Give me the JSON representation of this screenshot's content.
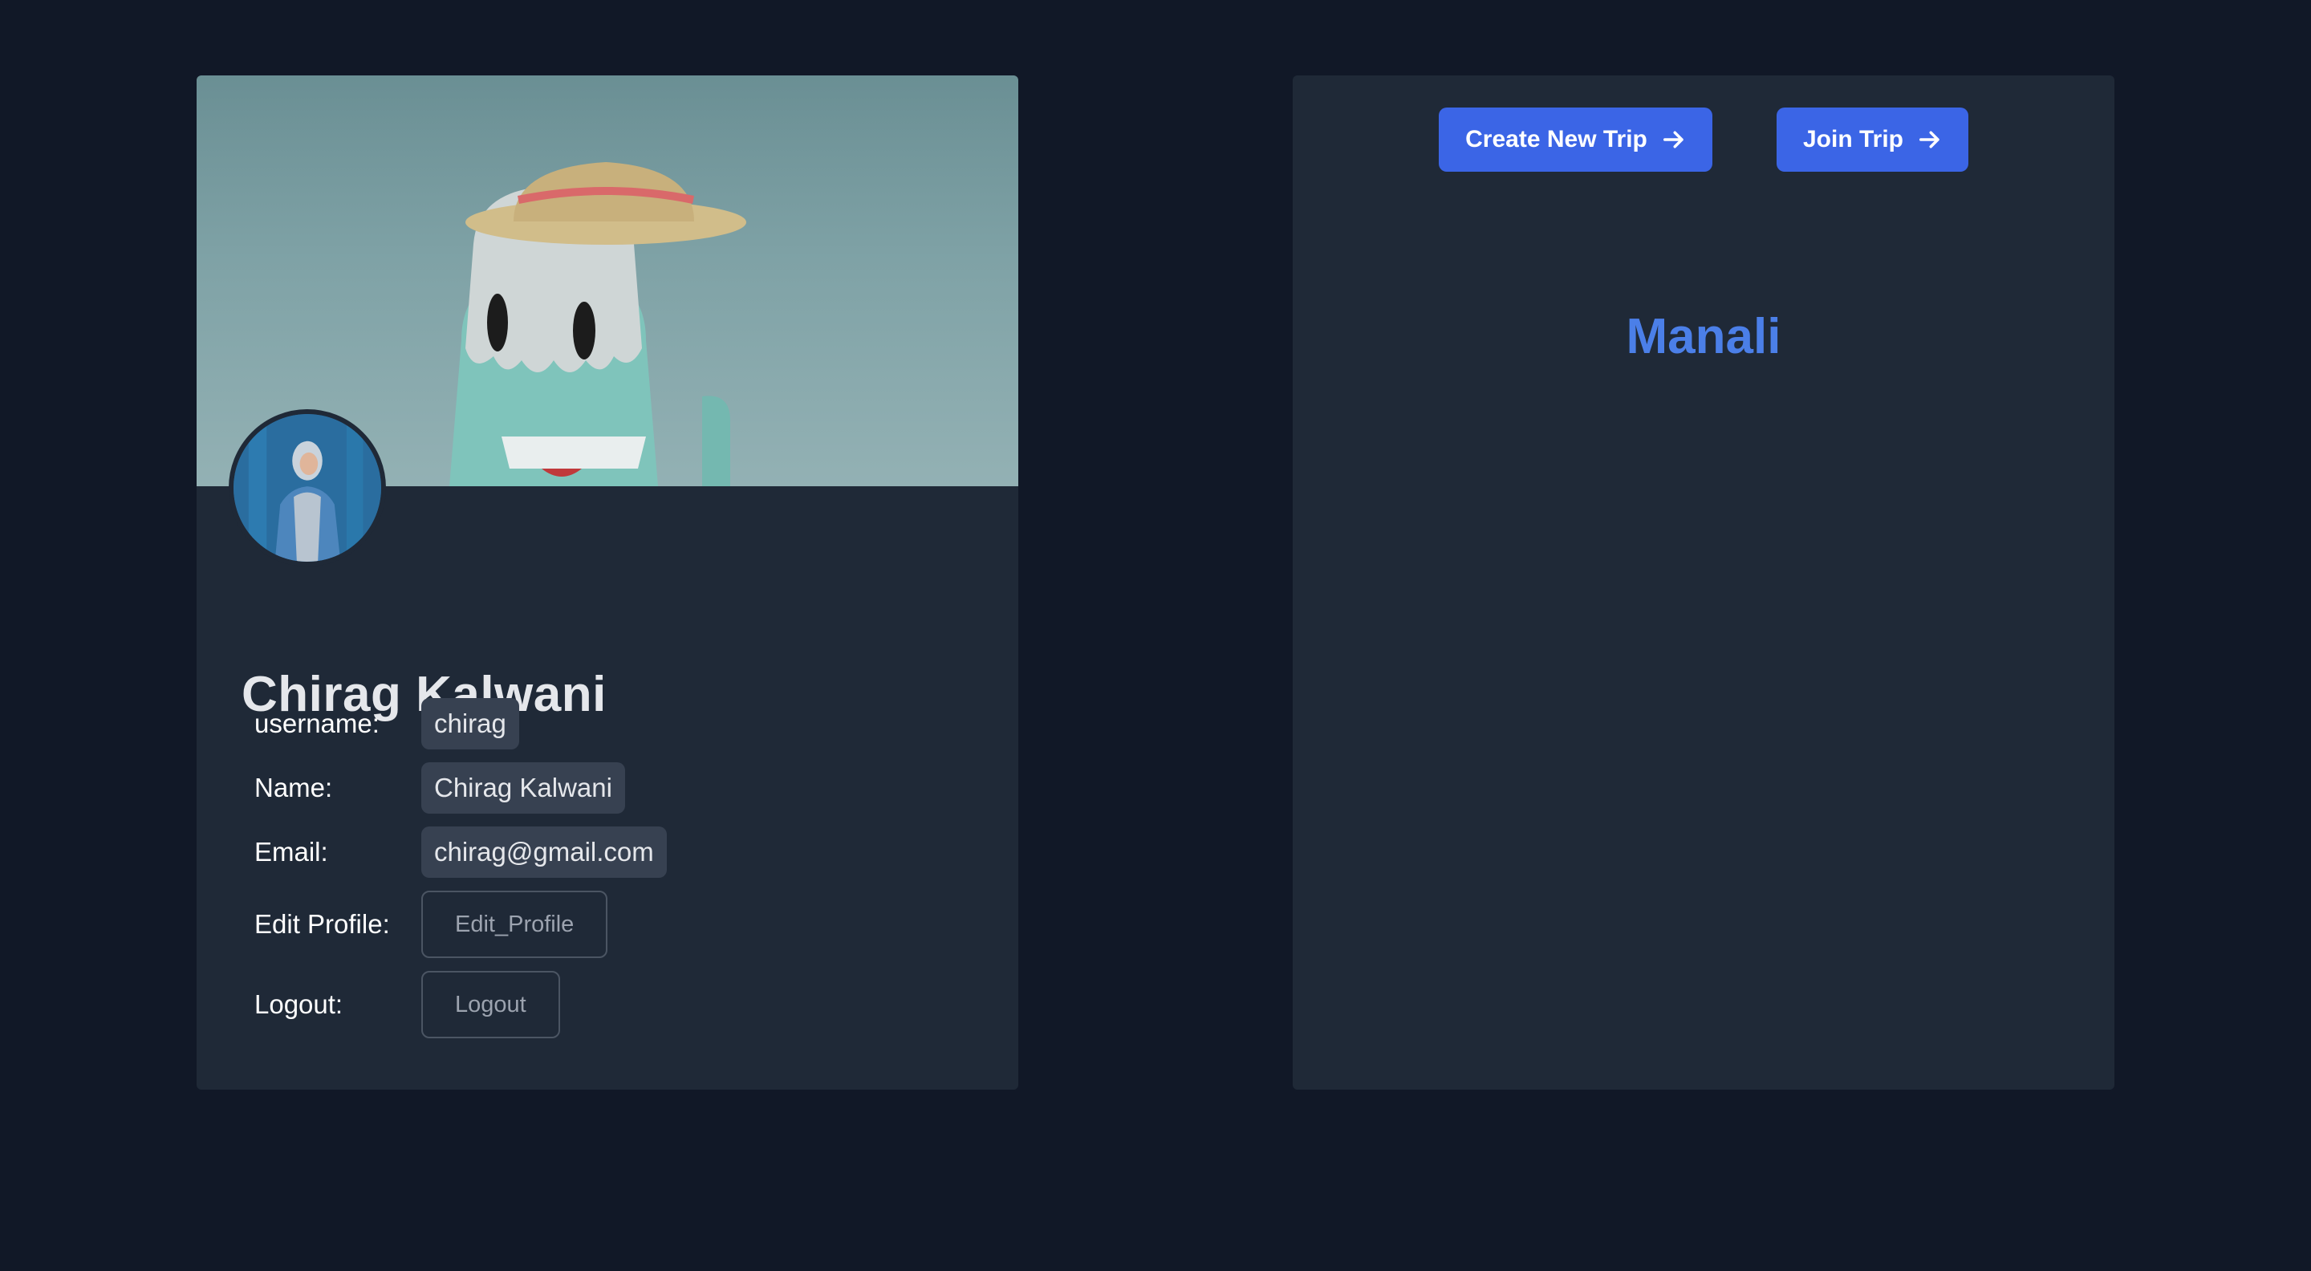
{
  "profile": {
    "name": "Chirag Kalwani",
    "fields": [
      {
        "label": "username:",
        "value": "chirag"
      },
      {
        "label": "Name:",
        "value": "Chirag Kalwani"
      },
      {
        "label": "Email:",
        "value": "chirag@gmail.com"
      }
    ],
    "edit_label": "Edit Profile:",
    "edit_button": "Edit_Profile",
    "logout_label": "Logout:",
    "logout_button": "Logout"
  },
  "trips": {
    "create_button": "Create New Trip",
    "join_button": "Join Trip",
    "trip_name": "Manali"
  },
  "icons": {
    "create_arrow": "arrow-right-icon",
    "join_arrow": "arrow-right-icon"
  },
  "colors": {
    "background": "#111827",
    "card": "#1f2937",
    "accent": "#3b65e6",
    "trip_title": "#4b7fe8"
  }
}
